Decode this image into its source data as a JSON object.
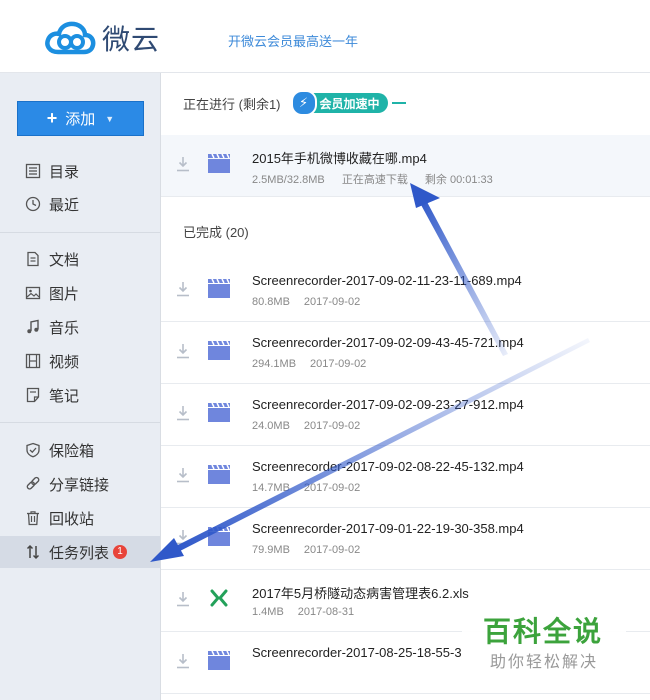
{
  "app": {
    "name": "微云",
    "promo": "开微云会员最高送一年"
  },
  "sidebar": {
    "add_label": "添加",
    "groups": [
      [
        {
          "label": "目录",
          "icon": "list-icon"
        },
        {
          "label": "最近",
          "icon": "clock-icon"
        }
      ],
      [
        {
          "label": "文档",
          "icon": "document-icon"
        },
        {
          "label": "图片",
          "icon": "image-icon"
        },
        {
          "label": "音乐",
          "icon": "music-icon"
        },
        {
          "label": "视频",
          "icon": "film-icon"
        },
        {
          "label": "笔记",
          "icon": "note-icon"
        }
      ],
      [
        {
          "label": "保险箱",
          "icon": "shield-icon"
        },
        {
          "label": "分享链接",
          "icon": "link-icon"
        },
        {
          "label": "回收站",
          "icon": "trash-icon"
        },
        {
          "label": "任务列表",
          "icon": "transfer-icon",
          "badge": "1",
          "active": true
        }
      ]
    ]
  },
  "tasks": {
    "in_progress_label": "正在进行 (剩余1)",
    "boost_label": "会员加速中",
    "active": {
      "name": "2015年手机微博收藏在哪.mp4",
      "size": "2.5MB/32.8MB",
      "status": "正在高速下载",
      "remaining": "剩余 00:01:33"
    },
    "done_label": "已完成 (20)",
    "done": [
      {
        "name": "Screenrecorder-2017-09-02-11-23-11-689.mp4",
        "size": "80.8MB",
        "date": "2017-09-02",
        "type": "video"
      },
      {
        "name": "Screenrecorder-2017-09-02-09-43-45-721.mp4",
        "size": "294.1MB",
        "date": "2017-09-02",
        "type": "video"
      },
      {
        "name": "Screenrecorder-2017-09-02-09-23-27-912.mp4",
        "size": "24.0MB",
        "date": "2017-09-02",
        "type": "video"
      },
      {
        "name": "Screenrecorder-2017-09-02-08-22-45-132.mp4",
        "size": "14.7MB",
        "date": "2017-09-02",
        "type": "video"
      },
      {
        "name": "Screenrecorder-2017-09-01-22-19-30-358.mp4",
        "size": "79.9MB",
        "date": "2017-09-02",
        "type": "video"
      },
      {
        "name": "2017年5月桥隧动态病害管理表6.2.xls",
        "size": "1.4MB",
        "date": "2017-08-31",
        "type": "excel"
      },
      {
        "name": "Screenrecorder-2017-08-25-18-55-3",
        "size": "",
        "date": "",
        "type": "video"
      }
    ]
  },
  "watermark": {
    "title": "百科全说",
    "subtitle": "助你轻松解决"
  },
  "colors": {
    "accent": "#2b8ae6",
    "arrow": "#3a5db8",
    "watermark_green": "#3ca33c"
  }
}
